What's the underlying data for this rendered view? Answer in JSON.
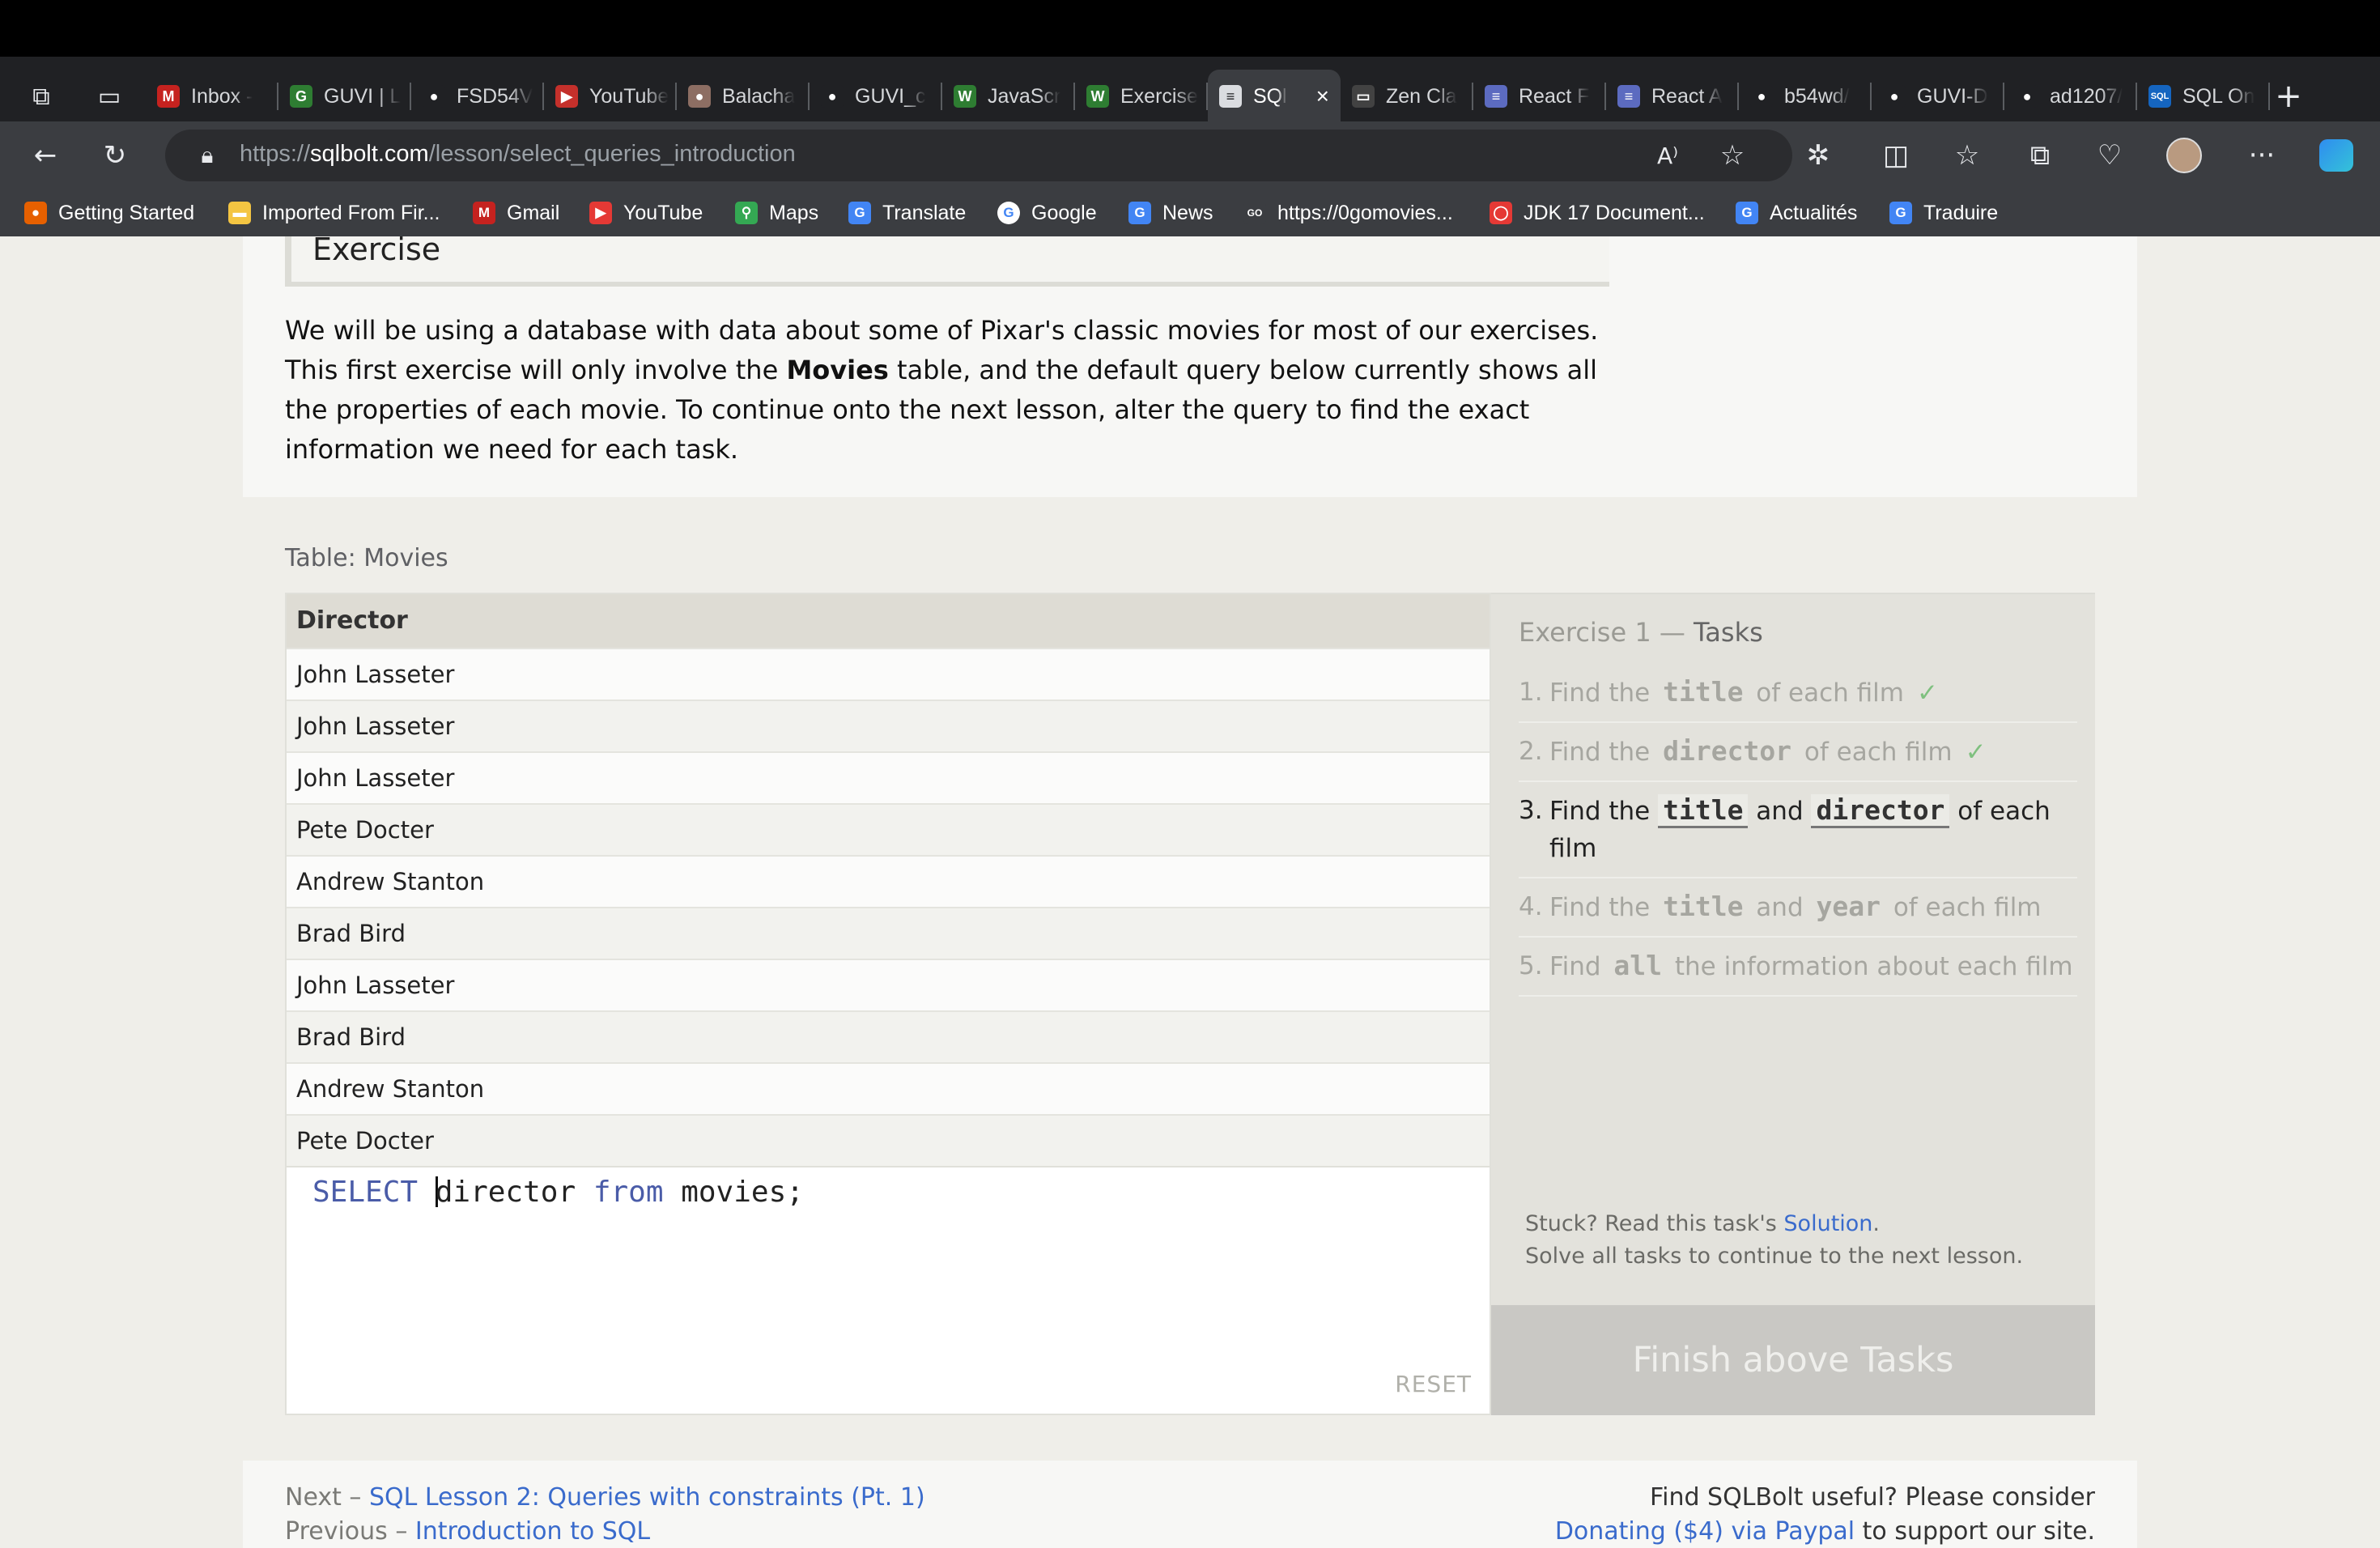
{
  "tabs": [
    {
      "label": "Inbox -",
      "icon": "gmail-icon",
      "color": "#c5221f",
      "glyph": "M"
    },
    {
      "label": "GUVI | L",
      "icon": "guvi-icon",
      "color": "#2e7d32",
      "glyph": "G"
    },
    {
      "label": "FSD54V",
      "icon": "github-icon",
      "color": "#202124",
      "glyph": "●"
    },
    {
      "label": "YouTube",
      "icon": "youtube-icon",
      "color": "#c4302b",
      "glyph": "▶"
    },
    {
      "label": "Balacha",
      "icon": "profile-icon",
      "color": "#8d6e63",
      "glyph": "●"
    },
    {
      "label": "GUVI_c",
      "icon": "github-icon",
      "color": "#202124",
      "glyph": "●"
    },
    {
      "label": "JavaScr",
      "icon": "w3schools-icon",
      "color": "#2e7d32",
      "glyph": "W"
    },
    {
      "label": "Exercise",
      "icon": "w3schools-icon",
      "color": "#2e7d32",
      "glyph": "W"
    },
    {
      "label": "SQl",
      "icon": "database-icon",
      "color": "#dadce0",
      "glyph": "≡"
    },
    {
      "label": "Zen Cla",
      "icon": "zen-icon",
      "color": "#424242",
      "glyph": "▭"
    },
    {
      "label": "React F",
      "icon": "document-icon",
      "color": "#5c6bc0",
      "glyph": "≡"
    },
    {
      "label": "React A",
      "icon": "document-icon",
      "color": "#5c6bc0",
      "glyph": "≡"
    },
    {
      "label": "b54wd/",
      "icon": "github-icon",
      "color": "#202124",
      "glyph": "●"
    },
    {
      "label": "GUVI-D",
      "icon": "github-icon",
      "color": "#202124",
      "glyph": "●"
    },
    {
      "label": "ad1207/",
      "icon": "github-icon",
      "color": "#202124",
      "glyph": "●"
    },
    {
      "label": "SQL On",
      "icon": "sql-online-icon",
      "color": "#1565c0",
      "glyph": "SQL"
    }
  ],
  "address_bar": {
    "scheme": "https://",
    "host": "sqlbolt.com",
    "path": "/lesson/select_queries_introduction"
  },
  "bookmarks": [
    {
      "label": "Getting Started",
      "icon": "firefox-icon",
      "color": "#e66000",
      "glyph": "●"
    },
    {
      "label": "Imported From Fir...",
      "icon": "folder-icon",
      "color": "#f4c542",
      "glyph": "▬"
    },
    {
      "label": "Gmail",
      "icon": "gmail-icon",
      "color": "#c5221f",
      "glyph": "M"
    },
    {
      "label": "YouTube",
      "icon": "youtube-icon",
      "color": "#e53935",
      "glyph": "▶"
    },
    {
      "label": "Maps",
      "icon": "maps-icon",
      "color": "#34a853",
      "glyph": "⚲"
    },
    {
      "label": "Translate",
      "icon": "translate-icon",
      "color": "#4285f4",
      "glyph": "G"
    },
    {
      "label": "Google",
      "icon": "google-icon",
      "color": "#ffffff",
      "glyph": "G"
    },
    {
      "label": "News",
      "icon": "news-icon",
      "color": "#4285f4",
      "glyph": "G"
    },
    {
      "label": "https://0gomovies...",
      "icon": "gomovies-icon",
      "color": "#3b3d41",
      "glyph": "GO"
    },
    {
      "label": "JDK 17 Document...",
      "icon": "java-icon",
      "color": "#e53935",
      "glyph": "◯"
    },
    {
      "label": "Actualités",
      "icon": "news-icon",
      "color": "#4285f4",
      "glyph": "G"
    },
    {
      "label": "Traduire",
      "icon": "translate-icon",
      "color": "#4285f4",
      "glyph": "G"
    }
  ],
  "exercise": {
    "heading": "Exercise",
    "paragraph_1": "We will be using a database with data about some of Pixar's classic movies for most of our exercises. This first exercise will only involve the ",
    "paragraph_bold": "Movies",
    "paragraph_2": " table, and the default query below currently shows all the properties of each movie. To continue onto the next lesson, alter the query to find the exact information we need for each task."
  },
  "table": {
    "caption": "Table: Movies",
    "column": "Director",
    "rows": [
      "John Lasseter",
      "John Lasseter",
      "John Lasseter",
      "Pete Docter",
      "Andrew Stanton",
      "Brad Bird",
      "John Lasseter",
      "Brad Bird",
      "Andrew Stanton",
      "Pete Docter"
    ]
  },
  "editor": {
    "kw_select": "SELECT",
    "col": "director",
    "kw_from": "from",
    "table": "movies;",
    "reset_label": "RESET"
  },
  "tasks": {
    "title_prefix": "Exercise 1 — ",
    "title_word": "Tasks",
    "items": [
      {
        "num": "1.",
        "t1": "Find the ",
        "c1": "title",
        "t2": " of each film",
        "c2": "",
        "t3": "",
        "done": true,
        "current": false
      },
      {
        "num": "2.",
        "t1": "Find the ",
        "c1": "director",
        "t2": " of each film",
        "c2": "",
        "t3": "",
        "done": true,
        "current": false
      },
      {
        "num": "3.",
        "t1": "Find the ",
        "c1": "title",
        "t2": " and ",
        "c2": "director",
        "t3": " of each film",
        "done": false,
        "current": true
      },
      {
        "num": "4.",
        "t1": "Find the ",
        "c1": "title",
        "t2": " and ",
        "c2": "year",
        "t3": " of each film",
        "done": false,
        "current": false
      },
      {
        "num": "5.",
        "t1": "Find ",
        "c1": "all",
        "t2": " the information about each film",
        "c2": "",
        "t3": "",
        "done": false,
        "current": false
      }
    ],
    "check_mark": "✓",
    "stuck_prefix": "Stuck? Read this task's ",
    "stuck_link": "Solution",
    "stuck_suffix": ".",
    "solve_all": "Solve all tasks to continue to the next lesson.",
    "finish_label": "Finish above Tasks"
  },
  "footer": {
    "next_prefix": "Next – ",
    "next_link": "SQL Lesson 2: Queries with constraints (Pt. 1)",
    "prev_prefix": "Previous – ",
    "prev_link": "Introduction to SQL",
    "support_line1": "Find SQLBolt useful? Please consider",
    "donate_link": "Donating ($4) via Paypal",
    "support_suffix": " to support our site."
  }
}
